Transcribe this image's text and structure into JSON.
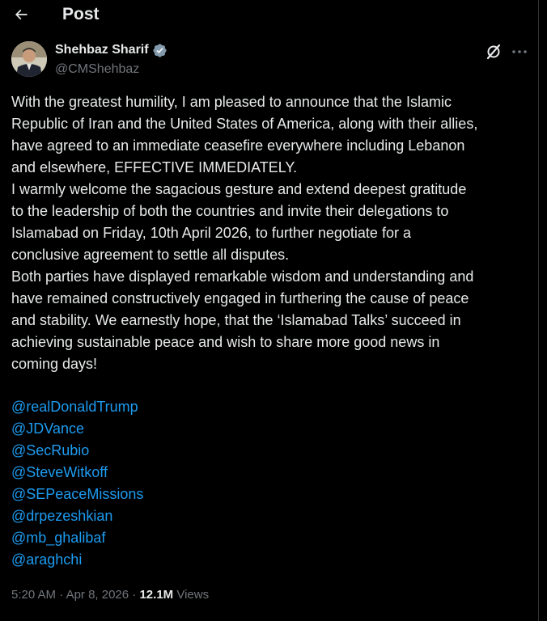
{
  "header": {
    "title": "Post"
  },
  "author": {
    "name": "Shehbaz Sharif",
    "handle": "@CMShehbaz",
    "verified": true
  },
  "post": {
    "paragraphs": [
      {
        "lines": [
          "With the greatest humility, I am pleased to announce that the Islamic",
          "Republic of Iran and the United States of America, along with their allies,",
          "have agreed to an immediate ceasefire everywhere including Lebanon",
          "and elsewhere, EFFECTIVE IMMEDIATELY."
        ]
      },
      {
        "lines": [
          "I warmly welcome the sagacious gesture and extend deepest gratitude",
          "to the leadership of both the countries and invite their delegations to",
          "Islamabad on Friday, 10th April 2026, to further negotiate for a",
          "conclusive agreement to settle all disputes."
        ]
      },
      {
        "lines": [
          "Both parties have displayed remarkable wisdom and understanding and",
          "have remained constructively engaged in furthering the cause of peace",
          "and stability. We earnestly hope, that the ‘Islamabad Talks’ succeed in",
          "achieving sustainable peace and wish to share more good news in",
          "coming days!"
        ]
      }
    ],
    "mentions": [
      "@realDonaldTrump",
      "@JDVance",
      "@SecRubio",
      "@SteveWitkoff",
      "@SEPeaceMissions",
      "@drpezeshkian",
      "@mb_ghalibaf",
      "@araghchi"
    ]
  },
  "meta": {
    "time": "5:20 AM",
    "separator": " · ",
    "date": "Apr 8, 2026",
    "views_count": "12.1M",
    "views_label": " Views"
  },
  "colors": {
    "background": "#000000",
    "text_primary": "#e7e9ea",
    "text_secondary": "#71767b",
    "link": "#1d9bf0",
    "verified_badge": "#71767b"
  },
  "icons": {
    "back": "arrow-left-icon",
    "verified": "verified-badge-icon",
    "grok": "grok-icon",
    "more": "more-horizontal-icon"
  }
}
